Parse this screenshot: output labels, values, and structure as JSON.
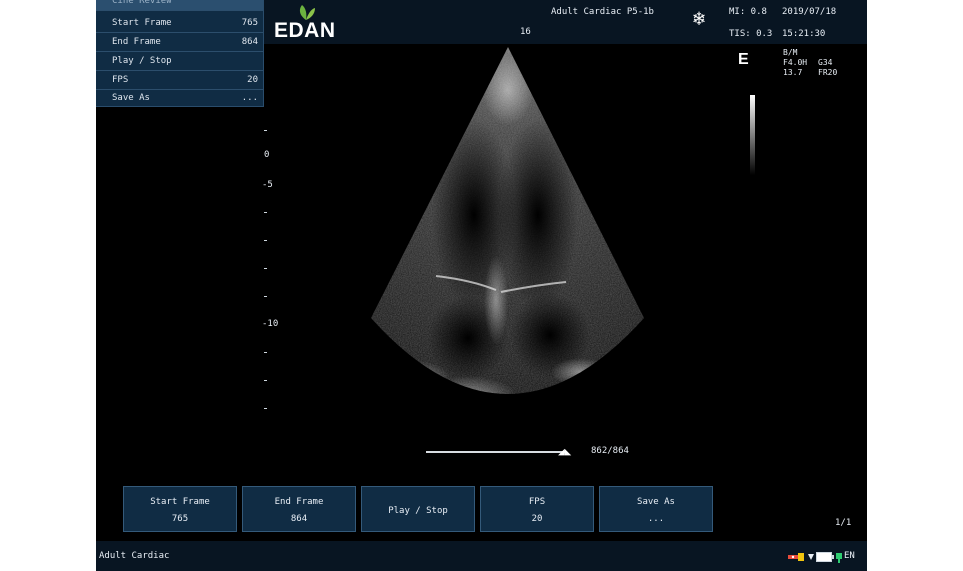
{
  "header": {
    "brand": "EDAN",
    "preset": "Adult Cardiac P5-1b",
    "depth_readout": "16",
    "mi": "MI: 0.8",
    "tis": "TIS: 0.3",
    "date": "2019/07/18",
    "time": "15:21:30"
  },
  "menu": {
    "title": "Cine Review",
    "items": [
      {
        "label": "Start Frame",
        "value": "765"
      },
      {
        "label": "End Frame",
        "value": "864"
      },
      {
        "label": "Play / Stop",
        "value": ""
      },
      {
        "label": "FPS",
        "value": "20"
      },
      {
        "label": "Save As",
        "value": "..."
      }
    ]
  },
  "image_params": {
    "mode_marker": "E",
    "line1_left": "B/M",
    "line2_left": "F4.0H",
    "line2_right": "G34",
    "line3_left": "13.7",
    "line3_right": "FR20"
  },
  "depth_scale": {
    "labels": [
      "0",
      "-5",
      "-10"
    ]
  },
  "cine": {
    "frame_counter": "862/864"
  },
  "softkeys": [
    {
      "line1": "Start Frame",
      "line2": "765"
    },
    {
      "line1": "End Frame",
      "line2": "864"
    },
    {
      "line1": "Play / Stop",
      "line2": ""
    },
    {
      "line1": "FPS",
      "line2": "20"
    },
    {
      "line1": "Save As",
      "line2": "..."
    }
  ],
  "pager": "1/1",
  "status": {
    "exam_type": "Adult Cardiac",
    "language": "EN"
  },
  "colors": {
    "panel": "#102c44",
    "header_bg": "#081522",
    "brand_leaf": "#6cb33f"
  }
}
